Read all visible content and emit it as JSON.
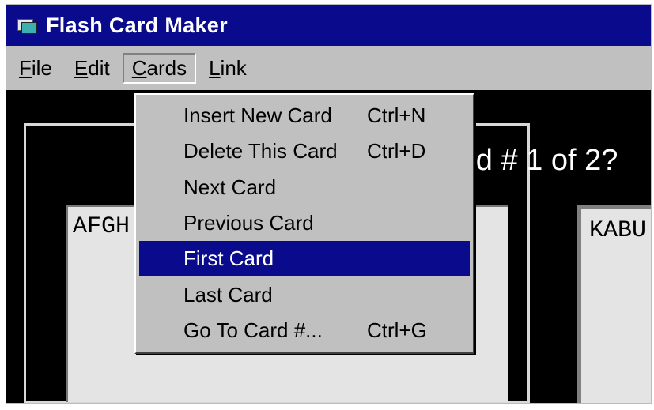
{
  "window": {
    "title": "Flash Card Maker"
  },
  "menubar": {
    "file": "File",
    "edit": "Edit",
    "cards": "Cards",
    "link": "Link"
  },
  "cards_menu": {
    "items": [
      {
        "label": "Insert New Card",
        "shortcut": "Ctrl+N"
      },
      {
        "label": "Delete This Card",
        "shortcut": "Ctrl+D"
      },
      {
        "label": "Next Card",
        "shortcut": ""
      },
      {
        "label": "Previous Card",
        "shortcut": ""
      },
      {
        "label": "First Card",
        "shortcut": ""
      },
      {
        "label": "Last Card",
        "shortcut": ""
      },
      {
        "label": "Go To Card #...",
        "shortcut": "Ctrl+G"
      }
    ],
    "highlighted_index": 4
  },
  "card_view": {
    "counter": "ard # 1 of 2?",
    "front_text": "AFGH",
    "back_text": "KABU"
  },
  "colors": {
    "titlebar": "#0a0a8c",
    "highlight": "#0a0a8c",
    "menu_bg": "#c0c0c0",
    "card_bg": "#e4e4e4"
  }
}
